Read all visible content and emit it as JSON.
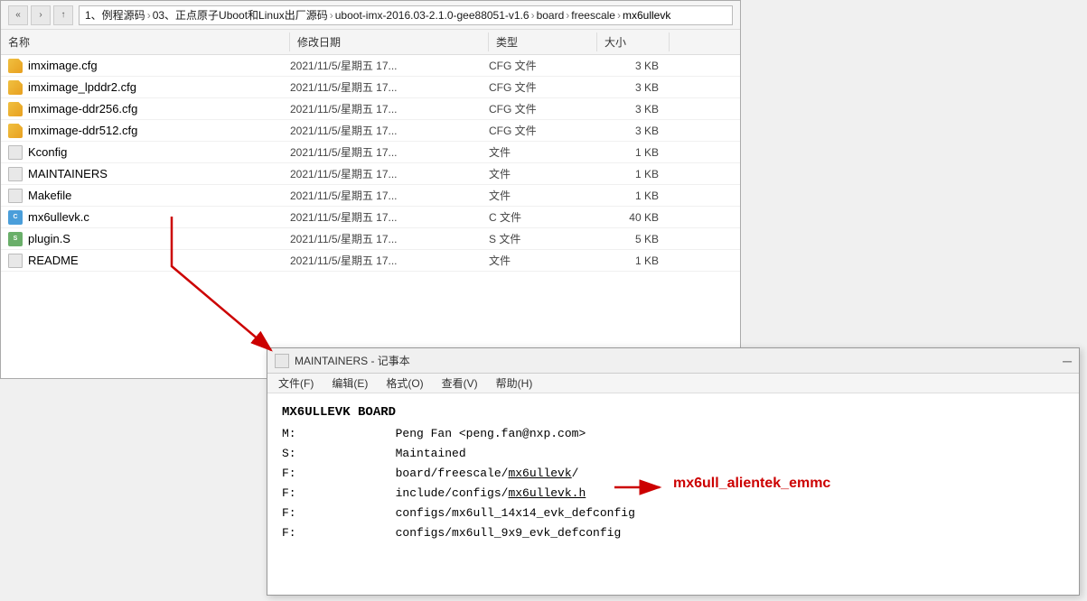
{
  "breadcrumb": {
    "items": [
      "1、例程源码",
      "03、正点原子Uboot和Linux出厂源码",
      "uboot-imx-2016.03-2.1.0-gee88051-v1.6",
      "board",
      "freescale",
      "mx6ullevk"
    ]
  },
  "columns": {
    "name": "名称",
    "date": "修改日期",
    "type": "类型",
    "size": "大小"
  },
  "files": [
    {
      "name": "imximage.cfg",
      "date": "2021/11/5/星期五 17...",
      "type": "CFG 文件",
      "size": "3 KB",
      "icon": "cfg"
    },
    {
      "name": "imximage_lpddr2.cfg",
      "date": "2021/11/5/星期五 17...",
      "type": "CFG 文件",
      "size": "3 KB",
      "icon": "cfg"
    },
    {
      "name": "imximage-ddr256.cfg",
      "date": "2021/11/5/星期五 17...",
      "type": "CFG 文件",
      "size": "3 KB",
      "icon": "cfg"
    },
    {
      "name": "imximage-ddr512.cfg",
      "date": "2021/11/5/星期五 17...",
      "type": "CFG 文件",
      "size": "3 KB",
      "icon": "cfg"
    },
    {
      "name": "Kconfig",
      "date": "2021/11/5/星期五 17...",
      "type": "文件",
      "size": "1 KB",
      "icon": "plain"
    },
    {
      "name": "MAINTAINERS",
      "date": "2021/11/5/星期五 17...",
      "type": "文件",
      "size": "1 KB",
      "icon": "plain"
    },
    {
      "name": "Makefile",
      "date": "2021/11/5/星期五 17...",
      "type": "文件",
      "size": "1 KB",
      "icon": "plain"
    },
    {
      "name": "mx6ullevk.c",
      "date": "2021/11/5/星期五 17...",
      "type": "C 文件",
      "size": "40 KB",
      "icon": "c-file"
    },
    {
      "name": "plugin.S",
      "date": "2021/11/5/星期五 17...",
      "type": "S 文件",
      "size": "5 KB",
      "icon": "s-file"
    },
    {
      "name": "README",
      "date": "2021/11/5/星期五 17...",
      "type": "文件",
      "size": "1 KB",
      "icon": "plain"
    }
  ],
  "notepad": {
    "title": "MAINTAINERS - 记事本",
    "icon_label": "📄",
    "menu": [
      "文件(F)",
      "编辑(E)",
      "格式(O)",
      "查看(V)",
      "帮助(H)"
    ],
    "content": {
      "heading": "MX6ULLEVK BOARD",
      "lines": [
        {
          "label": "M:",
          "value": "Peng Fan <peng.fan@nxp.com>"
        },
        {
          "label": "S:",
          "value": "Maintained"
        },
        {
          "label": "F:",
          "value": "board/freescale/",
          "underline": "mx6ullevk",
          "suffix": "/"
        },
        {
          "label": "F:",
          "value": "include/configs/",
          "underline": "mx6ullevk.h"
        },
        {
          "label": "F:",
          "value": "configs/mx6ull_14x14_evk_defconfig"
        },
        {
          "label": "F:",
          "value": "configs/mx6ull_9x9_evk_defconfig"
        }
      ]
    }
  },
  "annotation": {
    "text": "mx6ull_alientek_emmc"
  },
  "nav_buttons": [
    "←",
    "→",
    "↑"
  ],
  "minimize_label": "─"
}
